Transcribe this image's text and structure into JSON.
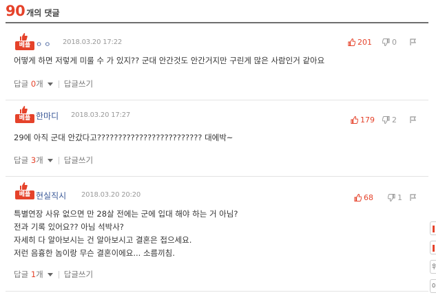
{
  "header": {
    "count": "90",
    "count_suffix": "개의 댓글"
  },
  "best_label": "베플",
  "comments": [
    {
      "author": "ㅇㅇ",
      "date": "2018.03.20 17:22",
      "likes": "201",
      "dislikes": "0",
      "lines": [
        "어떻게 하면 저렇게 미룰 수 가 있지?? 군대 안간것도 안간거지만 구린게 많은 사람인거 같아요"
      ],
      "reply_label": "답글",
      "reply_count": "0",
      "reply_unit": "개",
      "write_reply": "답글쓰기"
    },
    {
      "author": "한마디",
      "date": "2018.03.20 17:27",
      "likes": "179",
      "dislikes": "2",
      "lines": [
        "29에 아직 군대 안갔다고????????????????????????? 대에박~"
      ],
      "reply_label": "답글",
      "reply_count": "3",
      "reply_unit": "개",
      "write_reply": "답글쓰기"
    },
    {
      "author": "현실직시",
      "date": "2018.03.20 20:20",
      "likes": "68",
      "dislikes": "1",
      "lines": [
        "특별연장 사유 없으면 만 28살 전에는 군에 입대 해야 하는 거 아님?",
        "전과 기록 있어요?? 아님 석박사?",
        "자세히 다 알아보시는 건 알아보시고 결혼은 접으세요.",
        "저런 음흉한 놈이랑 무슨 결혼이에요... 소름끼침."
      ],
      "reply_label": "답글",
      "reply_count": "1",
      "reply_unit": "개",
      "write_reply": "답글쓰기"
    }
  ],
  "side_buttons": [
    "",
    "",
    "위",
    "아"
  ],
  "colors": {
    "accent": "#e5422a",
    "author_blue": "#3b5998",
    "muted": "#999999",
    "divider": "#e3e3e3"
  },
  "icons": [
    "thumbs-up-icon",
    "thumbs-down-icon",
    "report-flag-icon",
    "chevron-down-icon"
  ]
}
